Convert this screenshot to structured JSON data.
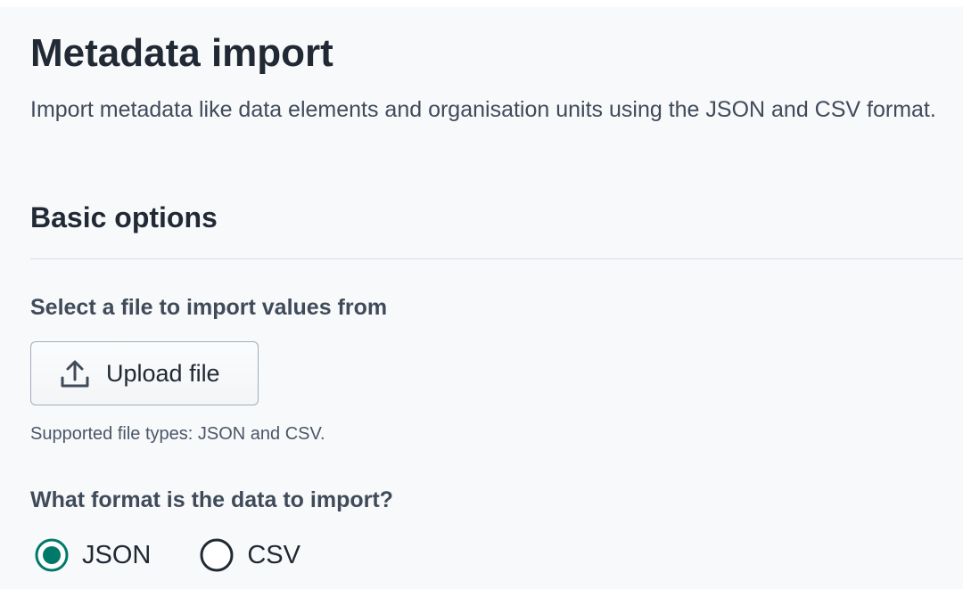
{
  "page": {
    "title": "Metadata import",
    "description": "Import metadata like data elements and organisation units using the JSON and CSV format."
  },
  "basic_options": {
    "title": "Basic options",
    "file_label": "Select a file to import values from",
    "upload_button_label": "Upload file",
    "upload_icon": "upload-icon",
    "help_text": "Supported file types: JSON and CSV.",
    "format_label": "What format is the data to import?",
    "format_options": [
      {
        "label": "JSON",
        "selected": true
      },
      {
        "label": "CSV",
        "selected": false
      }
    ]
  },
  "colors": {
    "accent": "#00796b",
    "text": "#212934",
    "secondary_text": "#404b5a",
    "panel_background": "#f8f9fb",
    "divider": "#d5dde5"
  }
}
